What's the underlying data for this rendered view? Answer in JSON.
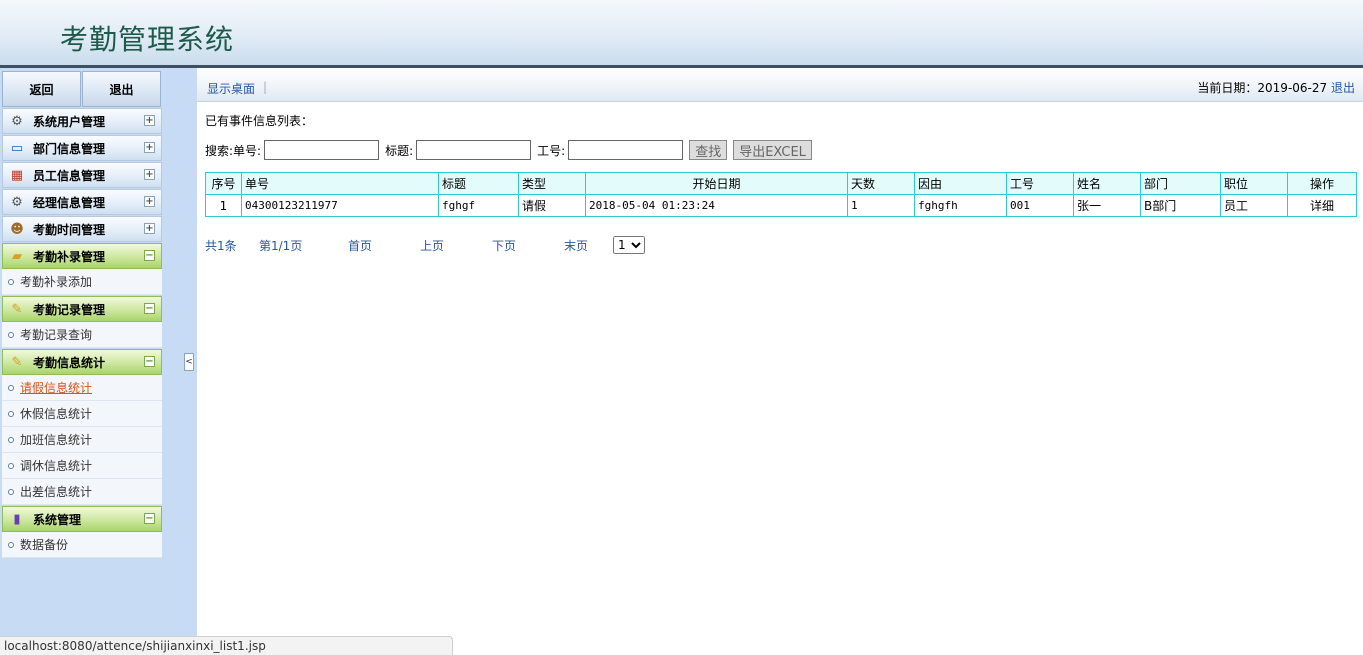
{
  "header": {
    "title": "考勤管理系统"
  },
  "sidebar": {
    "back_label": "返回",
    "exit_label": "退出",
    "menus": [
      {
        "label": "系统用户管理",
        "icon": "gear-icon",
        "open": false
      },
      {
        "label": "部门信息管理",
        "icon": "monitor-icon",
        "open": false
      },
      {
        "label": "员工信息管理",
        "icon": "calendar-icon",
        "open": false
      },
      {
        "label": "经理信息管理",
        "icon": "gear-icon",
        "open": false
      },
      {
        "label": "考勤时间管理",
        "icon": "person-icon",
        "open": false
      },
      {
        "label": "考勤补录管理",
        "icon": "folder-icon",
        "open": true,
        "items": [
          "考勤补录添加"
        ]
      },
      {
        "label": "考勤记录管理",
        "icon": "note-icon",
        "open": true,
        "items": [
          "考勤记录查询"
        ]
      },
      {
        "label": "考勤信息统计",
        "icon": "note-icon",
        "open": true,
        "items": [
          "请假信息统计",
          "休假信息统计",
          "加班信息统计",
          "调休信息统计",
          "出差信息统计"
        ],
        "active": 0
      },
      {
        "label": "系统管理",
        "icon": "chart-icon",
        "open": true,
        "items": [
          "数据备份"
        ]
      }
    ],
    "collapse_glyph": "<"
  },
  "toolbar": {
    "desk_label": "显示桌面",
    "separator": "|",
    "date_label": "当前日期：2019-06-27",
    "logout_label": "退出"
  },
  "list_title": "已有事件信息列表：",
  "search": {
    "prefix": "搜索: ",
    "no_label": "单号:",
    "title_label": "标题:",
    "worker_label": "工号:",
    "no_value": "",
    "title_value": "",
    "worker_value": "",
    "find_label": "查找",
    "export_label": "导出EXCEL"
  },
  "table": {
    "headers": [
      "序号",
      "单号",
      "标题",
      "类型",
      "开始日期",
      "天数",
      "因由",
      "工号",
      "姓名",
      "部门",
      "职位",
      "操作"
    ],
    "rows": [
      [
        "1",
        "04300123211977",
        "fghgf",
        "请假",
        "2018-05-04 01:23:24",
        "1",
        "fghgfh",
        "001",
        "张一",
        "B部门",
        "员工",
        "详细"
      ]
    ]
  },
  "pager": {
    "total": "共1条",
    "page": "第1/1页",
    "first": "首页",
    "prev": "上页",
    "next": "下页",
    "last": "末页",
    "select_value": "1"
  },
  "status": {
    "url": "localhost:8080/attence/shijianxinxi_list1.jsp"
  }
}
